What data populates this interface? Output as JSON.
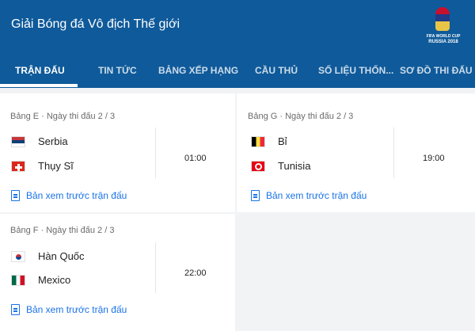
{
  "header": {
    "title": "Giải Bóng đá Vô địch Thế giới",
    "logo": {
      "line1": "FIFA WORLD CUP",
      "line2": "RUSSIA 2018"
    },
    "tabs": [
      {
        "label": "TRẬN ĐẤU",
        "active": true
      },
      {
        "label": "TIN TỨC",
        "active": false
      },
      {
        "label": "BẢNG XẾP HẠNG",
        "active": false
      },
      {
        "label": "CẦU THỦ",
        "active": false
      },
      {
        "label": "SỐ LIỆU THỐN...",
        "active": false
      },
      {
        "label": "SƠ ĐỒ THI ĐẤU",
        "active": false
      }
    ],
    "accent_color": "#0f5a9a"
  },
  "cards": [
    {
      "group": "Bảng E · Ngày thi đấu 2 / 3",
      "teams": [
        {
          "name": "Serbia",
          "flag": "serbia-flag-icon"
        },
        {
          "name": "Thụy Sĩ",
          "flag": "switzerland-flag-icon"
        }
      ],
      "time": "01:00",
      "preview": "Bản xem trước trận đấu"
    },
    {
      "group": "Bảng G · Ngày thi đấu 2 / 3",
      "teams": [
        {
          "name": "Bỉ",
          "flag": "belgium-flag-icon"
        },
        {
          "name": "Tunisia",
          "flag": "tunisia-flag-icon"
        }
      ],
      "time": "19:00",
      "preview": "Bản xem trước trận đấu"
    },
    {
      "group": "Bảng F · Ngày thi đấu 2 / 3",
      "teams": [
        {
          "name": "Hàn Quốc",
          "flag": "south-korea-flag-icon"
        },
        {
          "name": "Mexico",
          "flag": "mexico-flag-icon"
        }
      ],
      "time": "22:00",
      "preview": "Bản xem trước trận đấu"
    }
  ],
  "link_color": "#1a73e8"
}
